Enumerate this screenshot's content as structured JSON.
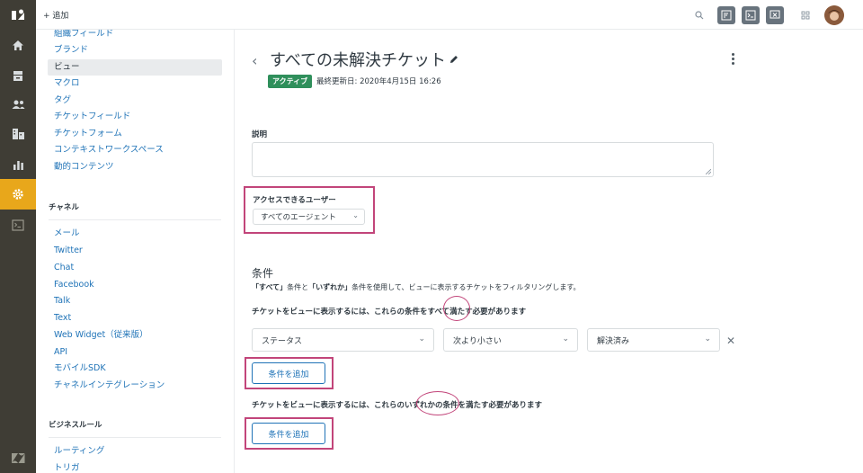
{
  "topbar": {
    "add_label": "+ 追加"
  },
  "rail": {
    "icons": [
      "zendesk-logo-icon",
      "home-icon",
      "views-icon",
      "customers-icon",
      "organizations-icon",
      "reporting-icon",
      "admin-settings-icon",
      "console-icon",
      "zendesk-products-icon"
    ]
  },
  "sidebar": {
    "manage_items": [
      "組織フィールド",
      "ブランド",
      "ビュー",
      "マクロ",
      "タグ",
      "チケットフィールド",
      "チケットフォーム",
      "コンテキストワークスペース",
      "動的コンテンツ"
    ],
    "channels_heading": "チャネル",
    "channel_items": [
      "メール",
      "Twitter",
      "Chat",
      "Facebook",
      "Talk",
      "Text",
      "Web Widget（従来版）",
      "API",
      "モバイルSDK",
      "チャネルインテグレーション"
    ],
    "business_heading": "ビジネスルール",
    "business_items": [
      "ルーティング",
      "トリガ"
    ]
  },
  "view": {
    "title": "すべての未解決チケット",
    "status_badge": "アクティブ",
    "updated": "最終更新日: 2020年4月15日 16:26",
    "description_label": "説明",
    "description_value": "",
    "access_label": "アクセスできるユーザー",
    "access_value": "すべてのエージェント",
    "conditions_heading": "条件",
    "conditions_help_all": "「すべて」",
    "conditions_help_mid": "条件と",
    "conditions_help_any": "「いずれか」",
    "conditions_help_end": "条件を使用して、ビューに表示するチケットをフィルタリングします。",
    "all_rule_pre": "チケットをビューに表示するには、これらの条件を",
    "all_rule_key": "すべて",
    "all_rule_post": "満たす必要があります",
    "condition_field": "ステータス",
    "condition_operator": "次より小さい",
    "condition_value": "解決済み",
    "add_condition_label": "条件を追加",
    "any_rule_pre": "チケットをビューに表示するには、これらの",
    "any_rule_key": "いずれか",
    "any_rule_post": "の条件を満たす必要があります"
  },
  "colors": {
    "rail": "#3f3d35",
    "active": "#e8a71b",
    "highlight": "#c2457a",
    "link": "#1f73b7",
    "badge": "#2f8f5b"
  }
}
